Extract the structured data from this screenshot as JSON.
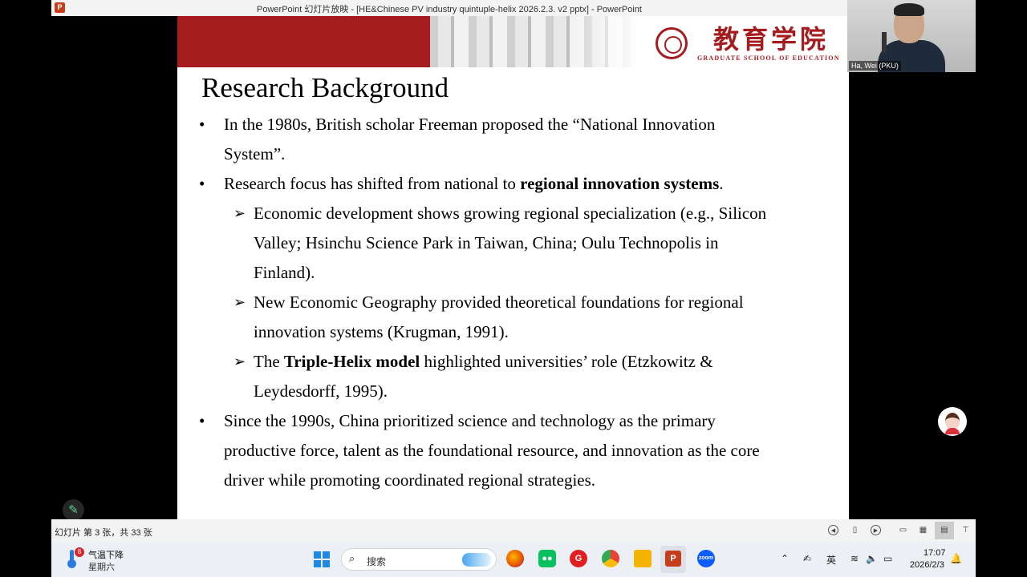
{
  "window": {
    "title": "PowerPoint 幻灯片放映 - [HE&Chinese PV industry quintuple-helix 2026.2.3. v2 pptx] - PowerPoint",
    "app_icon": "P"
  },
  "slide": {
    "header": {
      "logo_cn": "教育学院",
      "logo_en": "GRADUATE SCHOOL OF EDUCATION"
    },
    "title": "Research Background",
    "bullets": [
      {
        "marker": "•",
        "lines": [
          "In the 1980s, British scholar Freeman proposed the “National Innovation",
          "System”."
        ]
      },
      {
        "marker": "•",
        "pre": "Research focus has shifted from national to ",
        "bold": "regional innovation systems",
        "post": "."
      },
      {
        "marker": "•",
        "lines": [
          "Since the 1990s, China prioritized science and technology as the primary",
          "productive force, talent as the foundational resource, and innovation as the core",
          "driver while promoting coordinated regional strategies."
        ]
      }
    ],
    "sub_bullets": [
      {
        "marker": "➢",
        "lines": [
          "Economic development shows growing regional specialization (e.g., Silicon",
          "Valley; Hsinchu Science Park in Taiwan, China; Oulu Technopolis in",
          "Finland)."
        ]
      },
      {
        "marker": "➢",
        "lines": [
          "New Economic Geography provided theoretical foundations for regional",
          "innovation systems (Krugman, 1991)."
        ]
      },
      {
        "marker": "➢",
        "pre": "The ",
        "bold": "Triple-Helix model",
        "post": " highlighted universities’ role (Etzkowitz &",
        "line2": "Leydesdorff, 1995)."
      }
    ]
  },
  "video": {
    "participant_name": "Ha, Wei (PKU)"
  },
  "status_bar": {
    "slide_position": "幻灯片 第 3 张，共 33 张"
  },
  "taskbar": {
    "weather_badge": "8",
    "weather_text": "气温下降",
    "weekday": "星期六",
    "search_placeholder": "搜索",
    "ime_label": "英",
    "time": "17:07",
    "date": "2026/2/3",
    "apps": [
      "firefox-icon",
      "wechat-icon",
      "g-app-icon",
      "chrome-icon",
      "file-explorer-icon",
      "powerpoint-icon",
      "zoom-icon"
    ],
    "zoom_label": "zoom",
    "ppt_label": "P"
  },
  "colors": {
    "pku_red": "#a61b1e",
    "taskbar_bg": "#eceff3",
    "statusbar_bg": "#f3f3f3"
  }
}
